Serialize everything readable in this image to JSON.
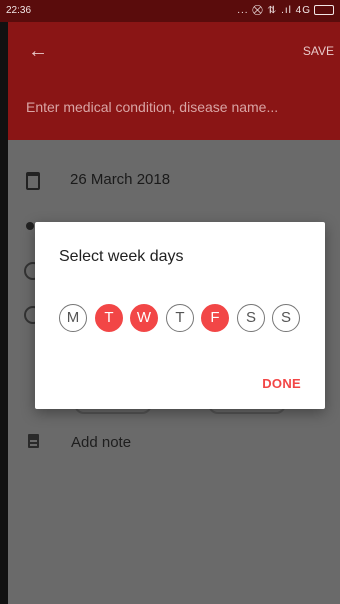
{
  "status": {
    "time": "22:36",
    "icons": "... ⛒ ⇅ .ıl 4G"
  },
  "appbar": {
    "save_label": "SAVE",
    "condition_placeholder": "Enter medical condition, disease name..."
  },
  "form": {
    "date": "26 March 2018",
    "note_label": "Add note"
  },
  "dialog": {
    "title": "Select week days",
    "days": [
      {
        "letter": "M",
        "selected": false
      },
      {
        "letter": "T",
        "selected": true
      },
      {
        "letter": "W",
        "selected": true
      },
      {
        "letter": "T",
        "selected": false
      },
      {
        "letter": "F",
        "selected": true
      },
      {
        "letter": "S",
        "selected": false
      },
      {
        "letter": "S",
        "selected": false
      }
    ],
    "done_label": "DONE"
  },
  "colors": {
    "appbar": "#8a1515",
    "accent": "#f24646",
    "overlay": "#6a6a6a"
  }
}
